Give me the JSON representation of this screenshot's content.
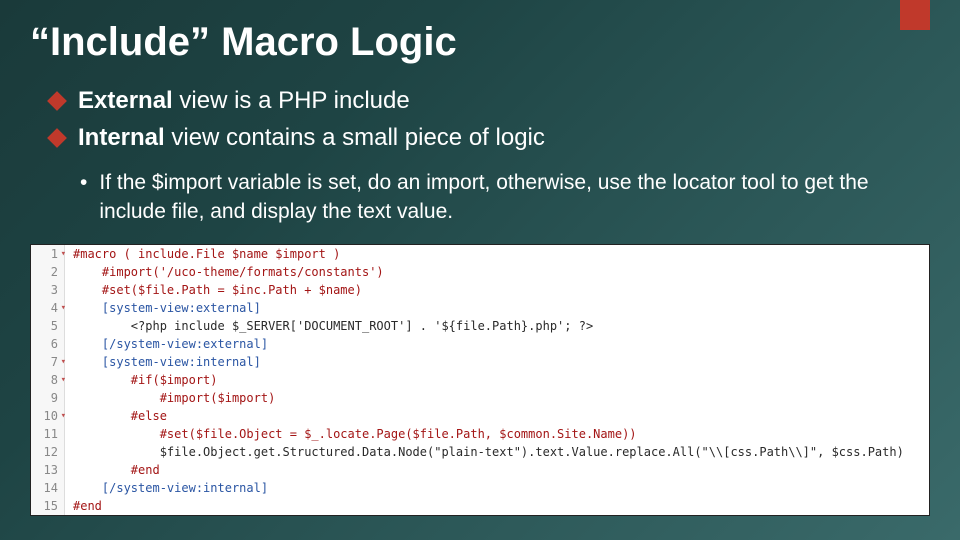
{
  "title": "“Include” Macro Logic",
  "bullets": [
    {
      "bold": "External",
      "rest": " view is a PHP include"
    },
    {
      "bold": "Internal",
      "rest": " view contains a small piece of logic"
    }
  ],
  "sub_bullet": "If the $import variable is set, do an import, otherwise, use the locator tool to get the include file, and display the text value.",
  "code": {
    "lines": [
      {
        "n": 1,
        "fold": true,
        "indent": 0,
        "cls": "c-dir",
        "text": "#macro ( include.File $name $import )"
      },
      {
        "n": 2,
        "fold": false,
        "indent": 1,
        "cls": "c-dir",
        "text": "#import('/uco-theme/formats/constants')"
      },
      {
        "n": 3,
        "fold": false,
        "indent": 1,
        "cls": "c-dir",
        "text": "#set($file.Path = $inc.Path + $name)"
      },
      {
        "n": 4,
        "fold": true,
        "indent": 1,
        "cls": "c-tag",
        "text": "[system-view:external]"
      },
      {
        "n": 5,
        "fold": false,
        "indent": 2,
        "cls": "",
        "text": "<?php include $_SERVER['DOCUMENT_ROOT'] . '${file.Path}.php'; ?>"
      },
      {
        "n": 6,
        "fold": false,
        "indent": 1,
        "cls": "c-tag",
        "text": "[/system-view:external]"
      },
      {
        "n": 7,
        "fold": true,
        "indent": 1,
        "cls": "c-tag",
        "text": "[system-view:internal]"
      },
      {
        "n": 8,
        "fold": true,
        "indent": 2,
        "cls": "c-dir",
        "text": "#if($import)"
      },
      {
        "n": 9,
        "fold": false,
        "indent": 3,
        "cls": "c-dir",
        "text": "#import($import)"
      },
      {
        "n": 10,
        "fold": true,
        "indent": 2,
        "cls": "c-dir",
        "text": "#else"
      },
      {
        "n": 11,
        "fold": false,
        "indent": 3,
        "cls": "c-dir",
        "text": "#set($file.Object = $_.locate.Page($file.Path, $common.Site.Name))"
      },
      {
        "n": 12,
        "fold": false,
        "indent": 3,
        "cls": "",
        "text": "$file.Object.get.Structured.Data.Node(\"plain-text\").text.Value.replace.All(\"\\\\[css.Path\\\\]\", $css.Path)"
      },
      {
        "n": 13,
        "fold": false,
        "indent": 2,
        "cls": "c-dir",
        "text": "#end"
      },
      {
        "n": 14,
        "fold": false,
        "indent": 1,
        "cls": "c-tag",
        "text": "[/system-view:internal]"
      },
      {
        "n": 15,
        "fold": false,
        "indent": 0,
        "cls": "c-dir",
        "text": "#end"
      }
    ]
  }
}
